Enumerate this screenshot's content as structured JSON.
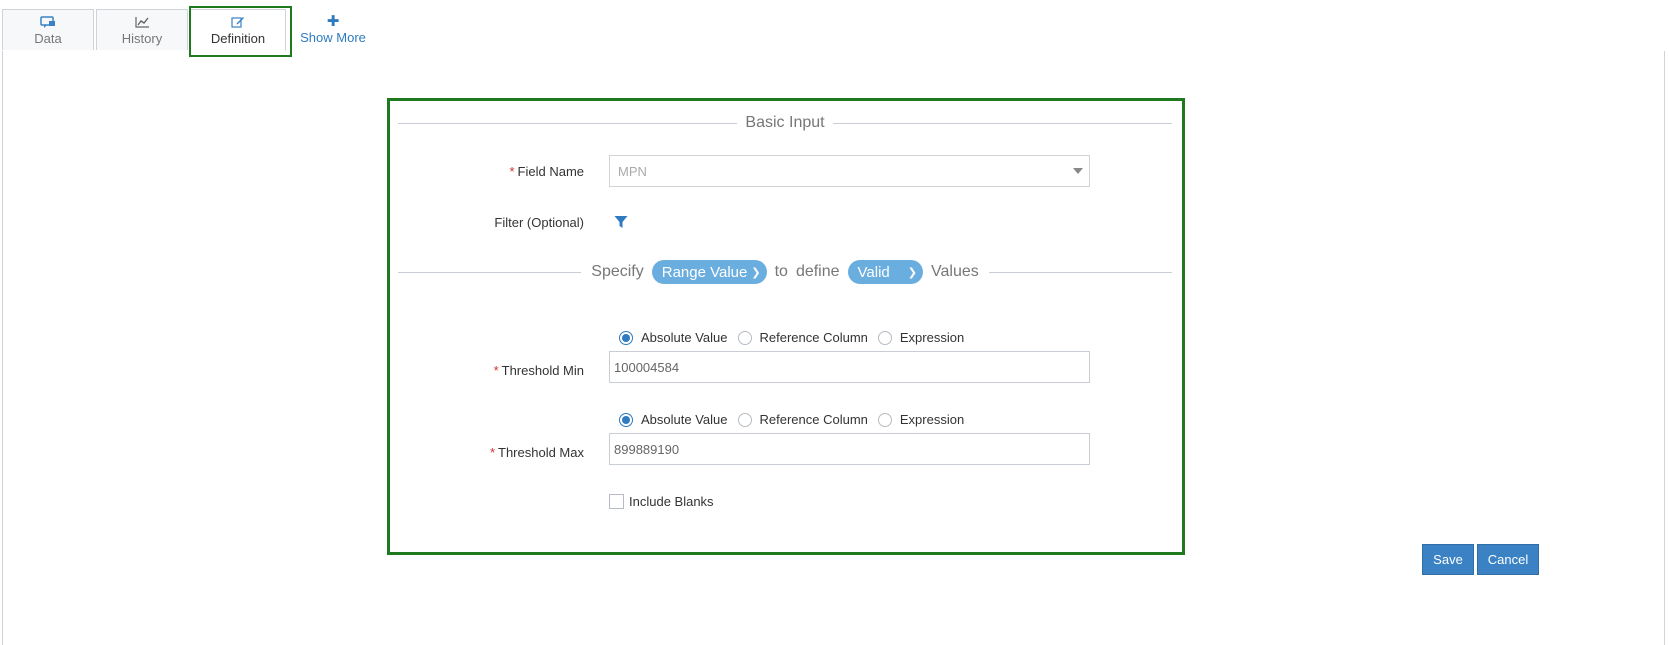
{
  "tabs": [
    {
      "label": "Data",
      "icon": "data-chat-icon"
    },
    {
      "label": "History",
      "icon": "line-chart-icon"
    },
    {
      "label": "Definition",
      "icon": "edit-icon",
      "active": true
    },
    {
      "label": "Show More",
      "icon": "plus-icon"
    }
  ],
  "form": {
    "legend": "Basic Input",
    "field_name": {
      "label": "Field Name",
      "required_mark": "*",
      "value": "MPN"
    },
    "filter": {
      "label": "Filter (Optional)",
      "icon": "filter-icon"
    },
    "spec": {
      "specify": "Specify",
      "mode": "Range Value",
      "to": "to",
      "define": "define",
      "validity": "Valid",
      "values": "Values"
    },
    "threshold_min": {
      "label": "Threshold Min",
      "required_mark": "*",
      "value": "100004584",
      "options": [
        "Absolute Value",
        "Reference Column",
        "Expression"
      ],
      "selected": "Absolute Value"
    },
    "threshold_max": {
      "label": "Threshold Max",
      "required_mark": "*",
      "value": "899889190",
      "options": [
        "Absolute Value",
        "Reference Column",
        "Expression"
      ],
      "selected": "Absolute Value"
    },
    "include_blanks": {
      "label": "Include Blanks",
      "checked": false
    }
  },
  "actions": {
    "save": "Save",
    "cancel": "Cancel"
  },
  "colors": {
    "accent": "#3a82c4",
    "highlight": "#1f7a1f",
    "pill": "#6aaee0",
    "required": "#d32f2f"
  }
}
